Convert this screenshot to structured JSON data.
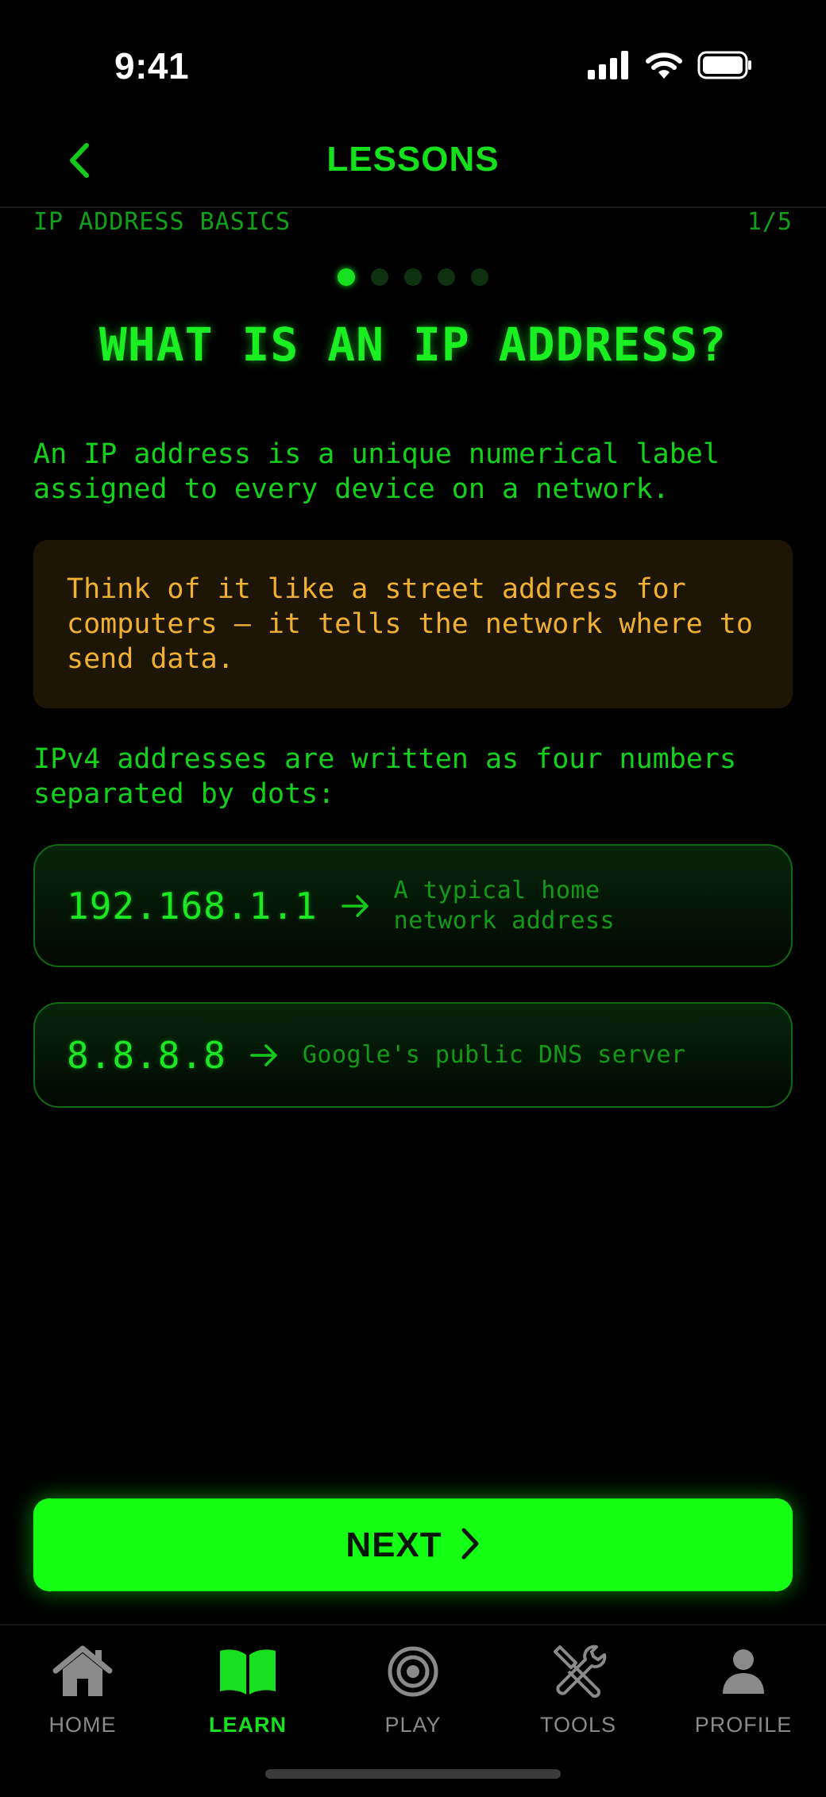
{
  "status_bar": {
    "time": "9:41"
  },
  "nav": {
    "title": "LESSONS"
  },
  "lesson": {
    "section": "IP ADDRESS BASICS",
    "progress": "1/5",
    "current_step": 1,
    "total_steps": 5,
    "title": "WHAT IS AN IP ADDRESS?",
    "paragraph_1": "An IP address is a unique numerical label assigned to every device on a network.",
    "tip": "Think of it like a street address for computers — it tells the network where to send data.",
    "paragraph_2": "IPv4 addresses are written as four numbers separated by dots:",
    "examples": [
      {
        "ip": "192.168.1.1",
        "description": "A typical home network address"
      },
      {
        "ip": "8.8.8.8",
        "description": "Google's public DNS server"
      }
    ]
  },
  "next_button": {
    "label": "NEXT"
  },
  "tabs": [
    {
      "label": "HOME",
      "icon": "home-icon",
      "active": false
    },
    {
      "label": "LEARN",
      "icon": "book-icon",
      "active": true
    },
    {
      "label": "PLAY",
      "icon": "target-icon",
      "active": false
    },
    {
      "label": "TOOLS",
      "icon": "tools-icon",
      "active": false
    },
    {
      "label": "PROFILE",
      "icon": "person-icon",
      "active": false
    }
  ],
  "colors": {
    "accent": "#15ff15",
    "text_green": "#14d21c",
    "tip_text": "#f0b030",
    "tip_background": "#1d1607",
    "background": "#000000"
  }
}
